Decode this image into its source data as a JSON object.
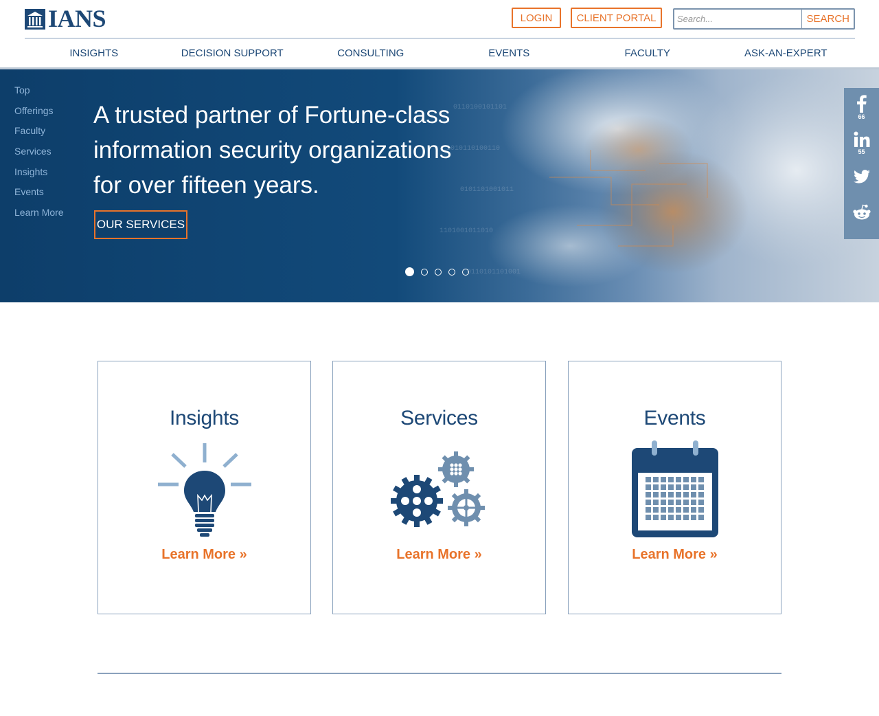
{
  "brand": {
    "name": "IANS"
  },
  "header": {
    "login_label": "LOGIN",
    "client_portal_label": "CLIENT PORTAL",
    "search_placeholder": "Search...",
    "search_button_label": "SEARCH"
  },
  "nav": {
    "items": [
      {
        "label": "INSIGHTS"
      },
      {
        "label": "DECISION SUPPORT"
      },
      {
        "label": "CONSULTING"
      },
      {
        "label": "EVENTS"
      },
      {
        "label": "FACULTY"
      },
      {
        "label": "ASK-AN-EXPERT"
      }
    ]
  },
  "side_nav": {
    "items": [
      {
        "label": "Top"
      },
      {
        "label": "Offerings"
      },
      {
        "label": "Faculty"
      },
      {
        "label": "Services"
      },
      {
        "label": "Insights"
      },
      {
        "label": "Events"
      },
      {
        "label": "Learn More"
      }
    ]
  },
  "hero": {
    "title": "A trusted partner of Fortune-class information security organizations for over fifteen years.",
    "button_label": "OUR SERVICES",
    "slide_count": 5,
    "active_slide": 1
  },
  "social": {
    "facebook": {
      "icon": "facebook-icon",
      "count": "66"
    },
    "linkedin": {
      "icon": "linkedin-icon",
      "count": "55"
    },
    "twitter": {
      "icon": "twitter-icon"
    },
    "reddit": {
      "icon": "reddit-icon"
    }
  },
  "cards": [
    {
      "title": "Insights",
      "icon": "lightbulb-icon",
      "link_label": "Learn More »"
    },
    {
      "title": "Services",
      "icon": "gears-icon",
      "link_label": "Learn More »"
    },
    {
      "title": "Events",
      "icon": "calendar-icon",
      "link_label": "Learn More »"
    }
  ],
  "colors": {
    "brand_navy": "#1d4876",
    "accent_orange": "#e8732a",
    "border_blue_gray": "#8aa2bd",
    "social_bar": "#6f8fae"
  }
}
